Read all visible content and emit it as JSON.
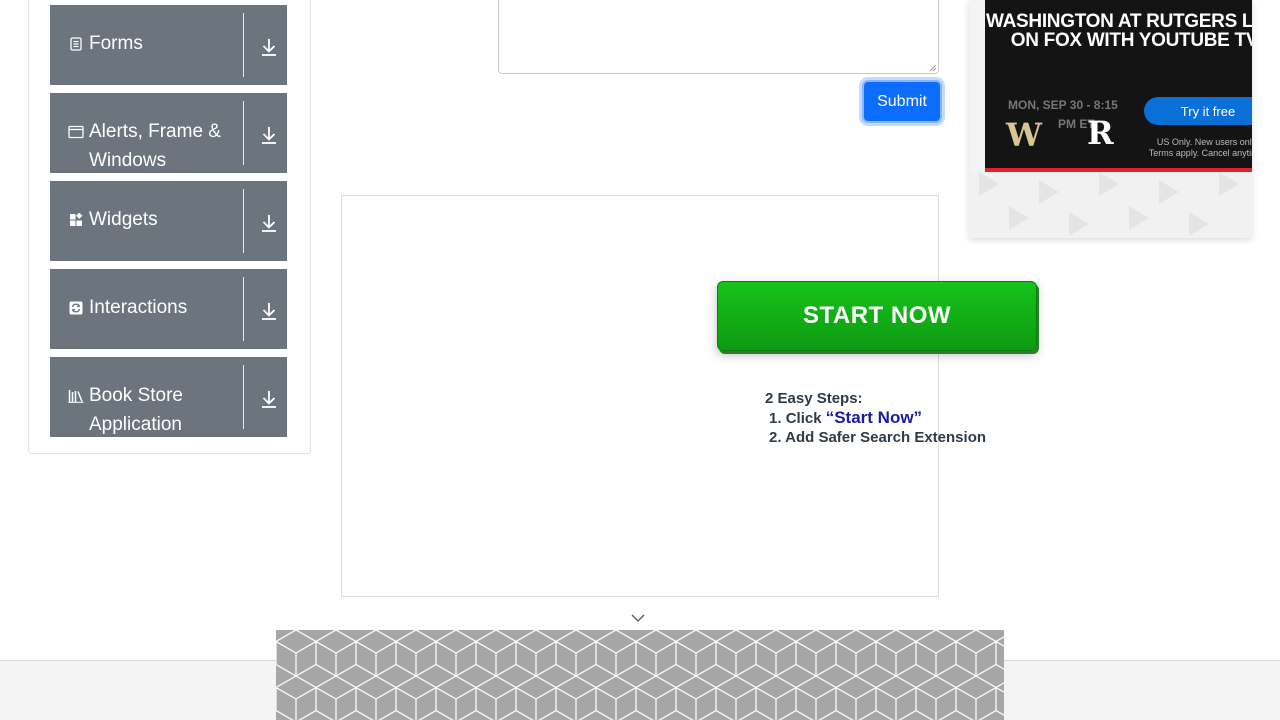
{
  "sidebar": {
    "groups": [
      {
        "label": "Forms",
        "icon": "form-icon"
      },
      {
        "label": "Alerts, Frame & Windows",
        "icon": "window-icon"
      },
      {
        "label": "Widgets",
        "icon": "widgets-icon"
      },
      {
        "label": "Interactions",
        "icon": "interactions-icon"
      },
      {
        "label": "Book Store Application",
        "icon": "book-store-icon"
      }
    ],
    "expand_icon": "download-arrow-icon"
  },
  "form": {
    "submit_label": "Submit",
    "submit_color": "#0d6efd"
  },
  "promo": {
    "button_label": "START NOW",
    "steps_heading": "2 Easy Steps:",
    "step1_prefix": "Click ",
    "step1_highlight": "“Start Now”",
    "step2": "Add Safer Search Extension",
    "button_color": "#0e9a12"
  },
  "right_ad": {
    "headline": "WASHINGTON AT RUTGERS LIVE ON FOX WITH YOUTUBE TV",
    "date_line1": "MON, SEP 30 - 8:15",
    "date_line2": "PM ET",
    "logo_left": "W",
    "logo_right": "R",
    "cta": "Try it free",
    "fine_print1": "US Only. New users only.",
    "fine_print2": "Terms apply. Cancel anytime.",
    "accent": "#e1202f"
  }
}
